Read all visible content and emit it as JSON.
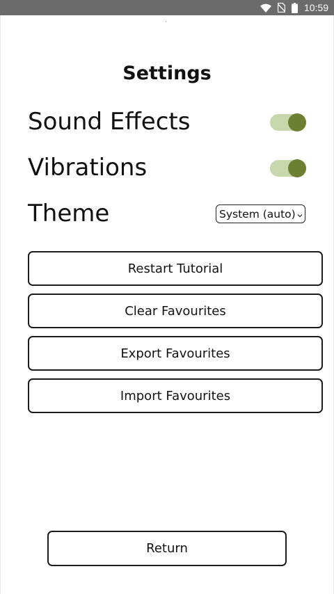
{
  "status_bar": {
    "time": "10:59",
    "icons": [
      "wifi-icon",
      "no-sim-icon",
      "battery-icon"
    ]
  },
  "settings": {
    "title": "Settings",
    "sound_effects": {
      "label": "Sound Effects",
      "enabled": true
    },
    "vibrations": {
      "label": "Vibrations",
      "enabled": true
    },
    "theme": {
      "label": "Theme",
      "selected": "System (auto)"
    }
  },
  "actions": {
    "restart_tutorial": "Restart Tutorial",
    "clear_favourites": "Clear Favourites",
    "export_favourites": "Export Favourites",
    "import_favourites": "Import Favourites"
  },
  "return_label": "Return",
  "colors": {
    "status_bar": "#6b6b6b",
    "toggle_track_on": "#c7d8ac",
    "toggle_knob_on": "#6c7f33"
  }
}
